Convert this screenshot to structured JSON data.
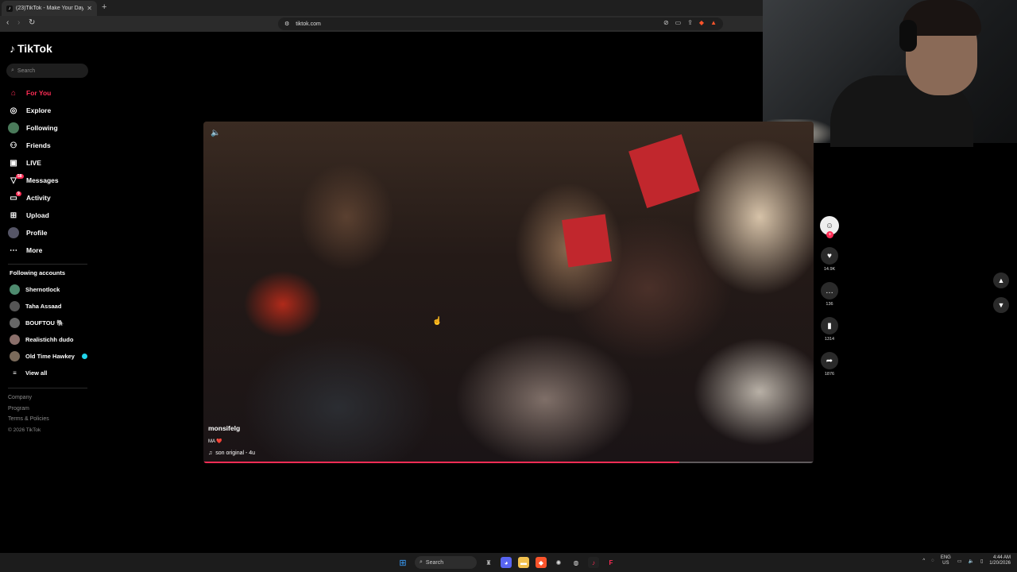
{
  "browser": {
    "tab_title": "(23)TikTok - Make Your Day",
    "tab_close": "✕",
    "new_tab": "+",
    "url": "tiktok.com"
  },
  "sidebar": {
    "logo": "TikTok",
    "search_placeholder": "Search",
    "nav": [
      {
        "label": "For You",
        "icon": "home-icon"
      },
      {
        "label": "Explore",
        "icon": "compass-icon"
      },
      {
        "label": "Following",
        "icon": "avatar"
      },
      {
        "label": "Friends",
        "icon": "friends-icon"
      },
      {
        "label": "LIVE",
        "icon": "live-icon"
      },
      {
        "label": "Messages",
        "icon": "messages-icon",
        "badge": "58"
      },
      {
        "label": "Activity",
        "icon": "activity-icon",
        "badge": "9"
      },
      {
        "label": "Upload",
        "icon": "upload-icon"
      },
      {
        "label": "Profile",
        "icon": "avatar"
      },
      {
        "label": "More",
        "icon": "more-icon"
      }
    ],
    "following_title": "Following accounts",
    "following": [
      {
        "name": "Shernotlock"
      },
      {
        "name": "Taha Assaad"
      },
      {
        "name": "BOUFTOU 🐘"
      },
      {
        "name": "Realistichh dudo"
      },
      {
        "name": "Old Time Hawkey"
      }
    ],
    "view_all": "View all",
    "footer": [
      "Company",
      "Program",
      "Terms & Policies"
    ],
    "copyright": "© 2026 TikTok"
  },
  "video": {
    "username": "monsifelg",
    "caption": "MA ❤️",
    "sound": "son original - 4u",
    "progress_fraction": 0.78
  },
  "actions": {
    "likes": "14.9K",
    "comments": "136",
    "saves": "1314",
    "shares": "1876"
  },
  "taskbar": {
    "search": "Search",
    "lang_top": "ENG",
    "lang_bottom": "US",
    "time": "4:44 AM",
    "date": "1/20/2026"
  }
}
